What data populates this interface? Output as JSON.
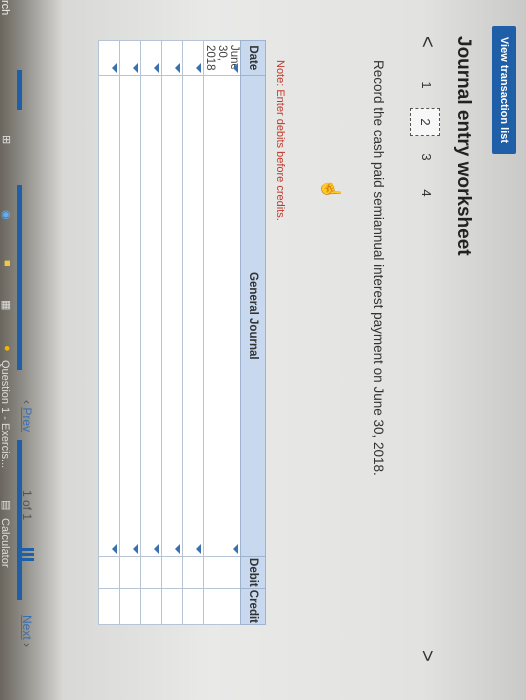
{
  "view_button": "View transaction list",
  "title": "Journal entry worksheet",
  "nav": {
    "prev_arrow": "<",
    "next_arrow": ">"
  },
  "steps": [
    "1",
    "2",
    "3",
    "4"
  ],
  "active_step": "2",
  "instruction": "Record the cash paid semiannual interest payment on June 30, 2018.",
  "note": "Note: Enter debits before credits.",
  "table": {
    "headers": [
      "Date",
      "General Journal",
      "Debit",
      "Credit"
    ],
    "rows": [
      [
        "June 30, 2018",
        "",
        "",
        ""
      ],
      [
        "",
        "",
        "",
        ""
      ],
      [
        "",
        "",
        "",
        ""
      ],
      [
        "",
        "",
        "",
        ""
      ],
      [
        "",
        "",
        "",
        ""
      ],
      [
        "",
        "",
        "",
        ""
      ]
    ]
  },
  "footer": {
    "prev": "Prev",
    "page": "1 of 1",
    "next": "Next"
  },
  "taskbar": {
    "search": "rch",
    "question": "Question 1 - Exercis...",
    "calculator": "Calculator"
  }
}
